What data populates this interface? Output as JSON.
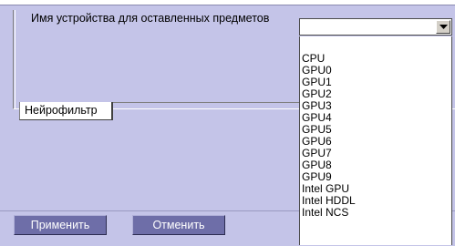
{
  "settings": {
    "device_label": "Имя устройства для оставленных предметов",
    "device_value": "",
    "device_options": [
      "CPU",
      "GPU0",
      "GPU1",
      "GPU2",
      "GPU3",
      "GPU4",
      "GPU5",
      "GPU6",
      "GPU7",
      "GPU8",
      "GPU9",
      "Intel GPU",
      "Intel HDDL",
      "Intel NCS"
    ],
    "dropdown_arrow_icon": "chevron-down-icon"
  },
  "tabs": [
    {
      "label": "Нейрофильтр"
    }
  ],
  "footer": {
    "apply_label": "Применить",
    "cancel_label": "Отменить"
  },
  "colors": {
    "panel_bg": "#c4c4e8",
    "button_bg": "#6e6ea8"
  }
}
